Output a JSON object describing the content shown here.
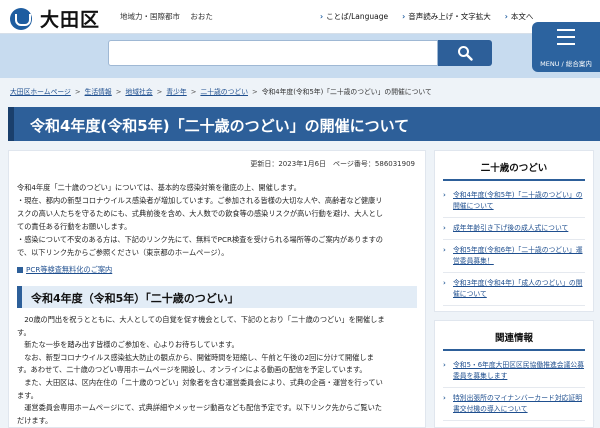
{
  "header": {
    "site_name": "大田区",
    "tagline": [
      "地域力・国際都市",
      "おおた"
    ],
    "util_links": [
      "ことば/Language",
      "音声読み上げ・文字拡大",
      "本文へ"
    ]
  },
  "search": {
    "placeholder": "",
    "button_label": ""
  },
  "menu": {
    "label": "MENU / 総合案内"
  },
  "breadcrumb": [
    "大田区ホームページ",
    "生活情報",
    "地域社会",
    "青少年",
    "二十歳のつどい",
    "令和4年度(令和5年)「二十歳のつどい」の開催について"
  ],
  "page": {
    "title": "令和4年度(令和5年)「二十歳のつどい」の開催について",
    "update": "更新日：2023年1月6日　ページ番号：586031909",
    "intro": [
      "令和4年度「二十歳のつどい」については、基本的な感染対策を徹底の上、開催します。",
      "・現在、都内の新型コロナウイルス感染者が増加しています。ご参加される皆様の大切な人や、高齢者など健康リ",
      "スクの高い人たちを守るためにも、式典前後を含め、大人数での飲食等の感染リスクが高い行動を避け、大人とし",
      "ての責任ある行動をお願いします。",
      "・感染について不安のある方は、下記のリンク先にて、無料でPCR検査を受けられる場所等のご案内がありますの",
      "で、以下リンク先からご参照ください（東京都のホームページ）。"
    ],
    "pcr_link": "PCR等検査無料化のご案内",
    "section_title": "令和4年度（令和5年）「二十歳のつどい」",
    "body": [
      "　20歳の門出を祝うとともに、大人としての自覚を促す機会として、下記のとおり「二十歳のつどい」を開催しま",
      "す。",
      "　新たな一歩を踏み出す皆様のご参加を、心よりお待ちしています。",
      "　なお、新型コロナウイルス感染拡大防止の観点から、開催時間を短縮し、午前と午後の2回に分けて開催しま",
      "す。あわせて、二十歳のつどい専用ホームページを開設し、オンラインによる動画の配信を予定しています。",
      "　また、大田区は、区内在住の「二十歳のつどい」対象者を含む運営委員会により、式典の企画・運営を行ってい",
      "ます。",
      "　運営委員会専用ホームページにて、式典詳細やメッセージ動画なども配信予定です。以下リンク先からご覧いた",
      "だけます。"
    ]
  },
  "sidebar": {
    "title": "二十歳のつどい",
    "items": [
      "令和4年度(令和5年)「二十歳のつどい」の開催について",
      "成年年齢引き下げ後の成人式について",
      "令和5年度(令和6年)「二十歳のつどい」運営委員募集！",
      "令和3年度(令和4年)「成人のつどい」の開催について"
    ]
  },
  "related": {
    "title": "関連情報",
    "items": [
      "令和5・6年度大田区区民協働推進会議公募委員を募集します",
      "特別出張所のマイナンバーカード対応証明書交付機の導入について"
    ]
  },
  "colors": {
    "primary": "#2d5f99",
    "band": "#c7dbef",
    "background": "#eef3f8"
  }
}
